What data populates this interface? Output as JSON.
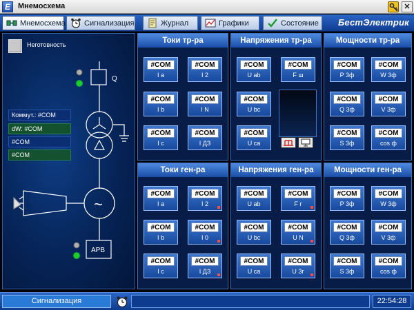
{
  "window": {
    "title": "Мнемосхема",
    "close_glyph": "✕"
  },
  "tabs": [
    {
      "label": "Мнемосхема",
      "icon": "schema-icon",
      "active": true
    },
    {
      "label": "Сигнализация",
      "icon": "alarm-clock-icon",
      "active": false
    },
    {
      "label": "Журнал",
      "icon": "journal-icon",
      "active": false
    },
    {
      "label": "Графики",
      "icon": "chart-icon",
      "active": false
    },
    {
      "label": "Состояние",
      "icon": "checkmark-icon",
      "active": false
    }
  ],
  "brand": "БестЭлектрик",
  "schema": {
    "unready_label": "Неготовность",
    "breaker_label": "Q",
    "regulator_label": "АРВ",
    "generator_symbol": "~",
    "info": [
      "Коммут.: #COM",
      "dW: #COM",
      "#COM",
      "#COM"
    ]
  },
  "groups": {
    "tr_currents": {
      "title": "Токи тр-ра",
      "meters": [
        {
          "value": "#COM",
          "label": "I a"
        },
        {
          "value": "#COM",
          "label": "I 2"
        },
        {
          "value": "#COM",
          "label": "I b"
        },
        {
          "value": "#COM",
          "label": "I N"
        },
        {
          "value": "#COM",
          "label": "I c"
        },
        {
          "value": "#COM",
          "label": "I ДЗ"
        }
      ]
    },
    "tr_voltages": {
      "title": "Напряжения тр-ра",
      "meters": [
        {
          "value": "#COM",
          "label": "U ab"
        },
        {
          "value": "#COM",
          "label": "F ш"
        },
        {
          "value": "#COM",
          "label": "U bc"
        },
        {
          "value": "#COM",
          "label": "U ca"
        }
      ]
    },
    "tr_powers": {
      "title": "Мощности тр-ра",
      "meters": [
        {
          "value": "#COM",
          "label": "P 3ф"
        },
        {
          "value": "#COM",
          "label": "W 3ф"
        },
        {
          "value": "#COM",
          "label": "Q 3ф"
        },
        {
          "value": "#COM",
          "label": "V 3ф"
        },
        {
          "value": "#COM",
          "label": "S 3ф"
        },
        {
          "value": "#COM",
          "label": "cos ф"
        }
      ]
    },
    "gen_currents": {
      "title": "Токи ген-ра",
      "meters": [
        {
          "value": "#COM",
          "label": "I a"
        },
        {
          "value": "#COM",
          "label": "I 2"
        },
        {
          "value": "#COM",
          "label": "I b"
        },
        {
          "value": "#COM",
          "label": "I 0"
        },
        {
          "value": "#COM",
          "label": "I c"
        },
        {
          "value": "#COM",
          "label": "I ДЗ"
        }
      ]
    },
    "gen_voltages": {
      "title": "Напряжения ген-ра",
      "meters": [
        {
          "value": "#COM",
          "label": "U ab"
        },
        {
          "value": "#COM",
          "label": "F г"
        },
        {
          "value": "#COM",
          "label": "U bc"
        },
        {
          "value": "#COM",
          "label": "U N"
        },
        {
          "value": "#COM",
          "label": "U ca"
        },
        {
          "value": "#COM",
          "label": "U 3г"
        }
      ]
    },
    "gen_powers": {
      "title": "Мощности ген-ра",
      "meters": [
        {
          "value": "#COM",
          "label": "P 3ф"
        },
        {
          "value": "#COM",
          "label": "W 3ф"
        },
        {
          "value": "#COM",
          "label": "Q 3ф"
        },
        {
          "value": "#COM",
          "label": "V 3ф"
        },
        {
          "value": "#COM",
          "label": "S 3ф"
        },
        {
          "value": "#COM",
          "label": "cos ф"
        }
      ]
    }
  },
  "statusbar": {
    "alarm_button": "Сигнализация",
    "message": "",
    "time": "22:54:28"
  },
  "colors": {
    "accent": "#1a4ea8",
    "panel": "#071d48",
    "ok_indicator": "#22cc22",
    "off_indicator": "#b0b0b0"
  }
}
